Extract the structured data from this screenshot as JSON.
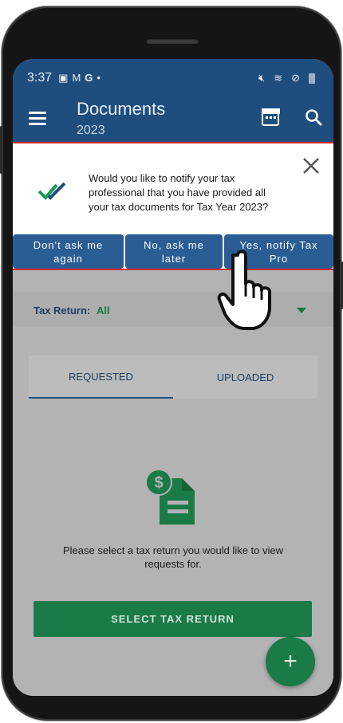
{
  "status_bar": {
    "time": "3:37"
  },
  "app_bar": {
    "title": "Documents",
    "year": "2023"
  },
  "popup": {
    "message": "Would you like to notify your tax professional that you have provided all your tax documents for Tax Year 2023?",
    "buttons": {
      "dont_ask": "Don't ask me again",
      "no_later": "No, ask me later",
      "yes_notify": "Yes, notify Tax Pro"
    }
  },
  "filter": {
    "label": "Tax Return:",
    "value": "All"
  },
  "tabs": {
    "requested": "REQUESTED",
    "uploaded": "UPLOADED"
  },
  "empty_state": {
    "message": "Please select a tax return you would like to view requests for."
  },
  "select_button": "SELECT TAX RETURN",
  "fab": "+",
  "colors": {
    "primary": "#1f4e7e",
    "accent_green": "#1a7a48",
    "highlight_border": "#d12a2a"
  },
  "icons": [
    "menu-icon",
    "calendar-icon",
    "search-icon",
    "checkmark-icon",
    "close-icon",
    "document-dollar-icon",
    "plus-icon",
    "pointer-hand-icon"
  ]
}
